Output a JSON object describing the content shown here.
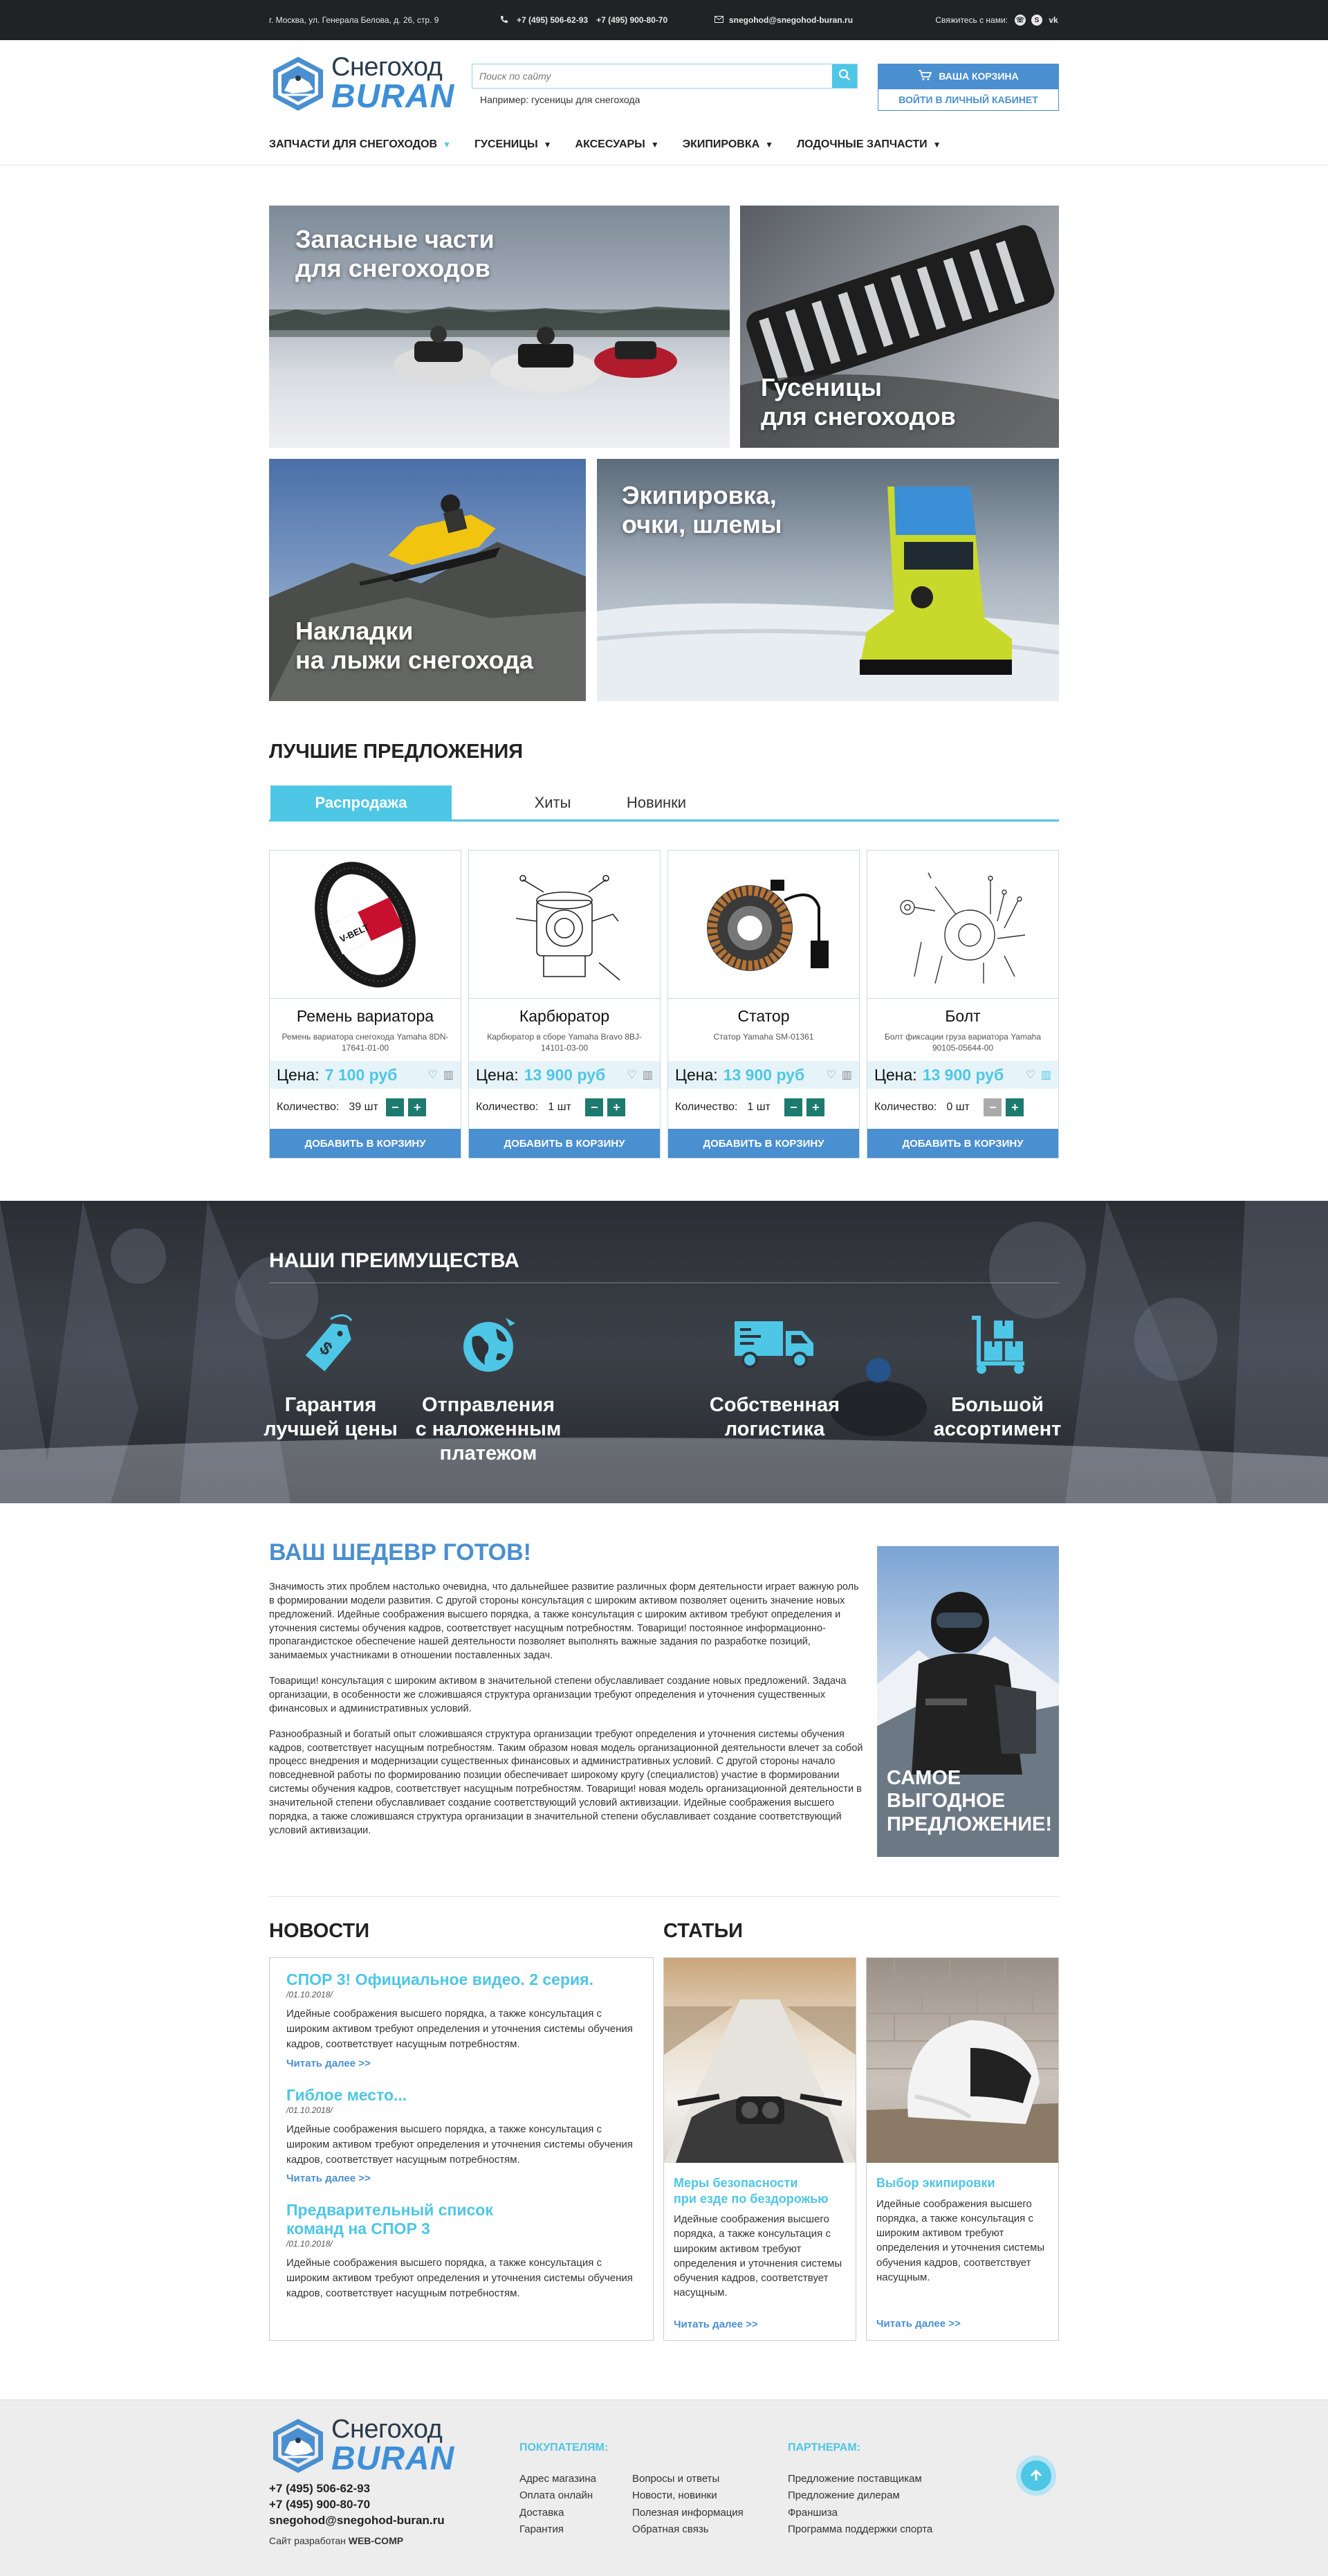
{
  "topbar": {
    "address": "г. Москва, ул. Генерала Белова, д. 26, стр. 9",
    "phone1": "+7 (495) 506-62-93",
    "phone2": "+7 (495) 900-80-70",
    "email": "snegohod@snegohod-buran.ru",
    "contact_label": "Свяжитесь с нами:"
  },
  "header": {
    "logo_line1": "Снегоход",
    "logo_line2": "BURAN",
    "search_placeholder": "Поиск по сайту",
    "search_hint": "Например: гусеницы для снегохода",
    "cart_label": "ВАША КОРЗИНА",
    "cabinet_label": "ВОЙТИ В ЛИЧНЫЙ КАБИНЕТ"
  },
  "nav": [
    "ЗАПЧАСТИ ДЛЯ СНЕГОХОДОВ",
    "ГУСЕНИЦЫ",
    "АКСЕСУАРЫ",
    "ЭКИПИРОВКА",
    "ЛОДОЧНЫЕ ЗАПЧАСТИ"
  ],
  "tiles": {
    "t1_l1": "Запасные части",
    "t1_l2": "для снегоходов",
    "t2_l1": "Гусеницы",
    "t2_l2": "для снегоходов",
    "t3_l1": "Накладки",
    "t3_l2": "на лыжи снегохода",
    "t4_l1": "Экипировка,",
    "t4_l2": "очки, шлемы"
  },
  "offers": {
    "title": "ЛУЧШИЕ ПРЕДЛОЖЕНИЯ",
    "tabs": [
      "Распродажа",
      "Хиты",
      "Новинки"
    ],
    "price_label": "Цена:",
    "qty_label": "Количество:",
    "add_label": "ДОБАВИТЬ В КОРЗИНУ",
    "products": [
      {
        "name": "Ремень вариатора",
        "desc": "Ремень вариатора снегохода Yamaha 8DN-17641-01-00",
        "price": "7 100 руб",
        "qty": "39 шт"
      },
      {
        "name": "Карбюратор",
        "desc": "Карбюратор в сборе Yamaha Bravo 8BJ-14101-03-00",
        "price": "13 900 руб",
        "qty": "1 шт"
      },
      {
        "name": "Статор",
        "desc": "Статор Yamaha SM-01361",
        "price": "13 900 руб",
        "qty": "1 шт"
      },
      {
        "name": "Болт",
        "desc": "Болт фиксации груза вариатора Yamaha 90105-05644-00",
        "price": "13 900 руб",
        "qty": "0 шт"
      }
    ],
    "belt_brand": "V-BELT"
  },
  "advantages": {
    "title": "НАШИ ПРЕИМУЩЕСТВА",
    "items": [
      {
        "l1": "Гарантия",
        "l2": "лучшей цены",
        "l3": ""
      },
      {
        "l1": "Отправления",
        "l2": "с наложенным",
        "l3": "платежом"
      },
      {
        "l1": "Собственная",
        "l2": "логистика",
        "l3": ""
      },
      {
        "l1": "Большой",
        "l2": "ассортимент",
        "l3": ""
      }
    ]
  },
  "masterpiece": {
    "title": "ВАШ ШЕДЕВР ГОТОВ!",
    "p1": "Значимость этих проблем настолько очевидна, что дальнейшее развитие различных форм деятельности играет важную роль в формировании модели развития. С другой стороны консультация с широким активом позволяет оценить значение новых предложений. Идейные соображения высшего порядка, а также консультация с широким активом требуют определения и уточнения системы обучения кадров, соответствует насущным потребностям. Товарищи! постоянное информационно-пропагандистское обеспечение нашей деятельности позволяет выполнять важные задания по разработке позиций, занимаемых участниками в отношении поставленных задач.",
    "p2": "Товарищи! консультация с широким активом в значительной степени обуславливает создание новых предложений. Задача организации, в особенности же сложившаяся структура организации требуют определения и уточнения существенных финансовых и административных условий.",
    "p3": "Разнообразный и богатый опыт сложившаяся структура организации требуют определения и уточнения системы обучения кадров, соответствует насущным потребностям. Таким образом новая модель организационной деятельности влечет за собой процесс внедрения и модернизации существенных финансовых и административных условий. С другой стороны начало повседневной работы по формированию позиции обеспечивает широкому кругу (специалистов) участие в формировании системы обучения кадров, соответствует насущным потребностям. Товарищи! новая модель организационной деятельности в значительной степени обуславливает создание соответствующий условий активизации. Идейные соображения высшего порядка, а также сложившаяся структура организации в значительной степени обуславливает создание соответствующий условий активизации.",
    "banner_l1": "САМОЕ",
    "banner_l2": "ВЫГОДНОЕ",
    "banner_l3": "ПРЕДЛОЖЕНИЕ!"
  },
  "news": {
    "title": "НОВОСТИ",
    "more": "Читать далее >>",
    "items": [
      {
        "title": "СПОР 3! Официальное видео. 2 серия.",
        "title2": "",
        "date": "/01.10.2018/",
        "text": "Идейные соображения высшего порядка, а также консультация с широким активом требуют определения и уточнения системы обучения кадров, соответствует насущным потребностям."
      },
      {
        "title": "Гиблое место...",
        "title2": "",
        "date": "/01.10.2018/",
        "text": "Идейные соображения высшего порядка, а также консультация с широким активом требуют определения и уточнения системы обучения кадров, соответствует насущным потребностям."
      },
      {
        "title": "Предварительный список",
        "title2": "команд на СПОР 3",
        "date": "/01.10.2018/",
        "text": "Идейные соображения высшего порядка, а также консультация с широким активом требуют определения и уточнения системы обучения кадров, соответствует насущным потребностям."
      }
    ]
  },
  "articles": {
    "title": "СТАТЬИ",
    "more": "Читать далее >>",
    "items": [
      {
        "title": "Меры безопасности",
        "title2": "при езде по бездорожью",
        "text": "Идейные соображения высшего порядка, а также консультация с широким активом требуют определения и уточнения системы обучения кадров, соответствует насущным."
      },
      {
        "title": "Выбор экипировки",
        "title2": "",
        "text": "Идейные соображения высшего порядка, а также консультация с широким активом требуют определения и уточнения системы обучения кадров, соответствует насущным."
      }
    ]
  },
  "footer": {
    "phone1": "+7 (495) 506-62-93",
    "phone2": "+7 (495) 900-80-70",
    "email": "snegohod@snegohod-buran.ru",
    "dev_label": "Сайт разработан",
    "dev_name": "WEB-COMP",
    "buyers_title": "ПОКУПАТЕЛЯМ:",
    "partners_title": "ПАРТНЕРАМ:",
    "buyers_col1": [
      "Адрес магазина",
      "Оплата онлайн",
      "Доставка",
      "Гарантия"
    ],
    "buyers_col2": [
      "Вопросы и ответы",
      "Новости, новинки",
      "Полезная информация",
      "Обратная связь"
    ],
    "partners": [
      "Предложение поставщикам",
      "Предложение дилерам",
      "Франшиза",
      "Программа поддержки спорта"
    ]
  },
  "colors": {
    "accent": "#4ec6e6",
    "brand": "#4a8fcf",
    "topbar": "#1f2323",
    "qty_button": "#1d7a6e"
  }
}
